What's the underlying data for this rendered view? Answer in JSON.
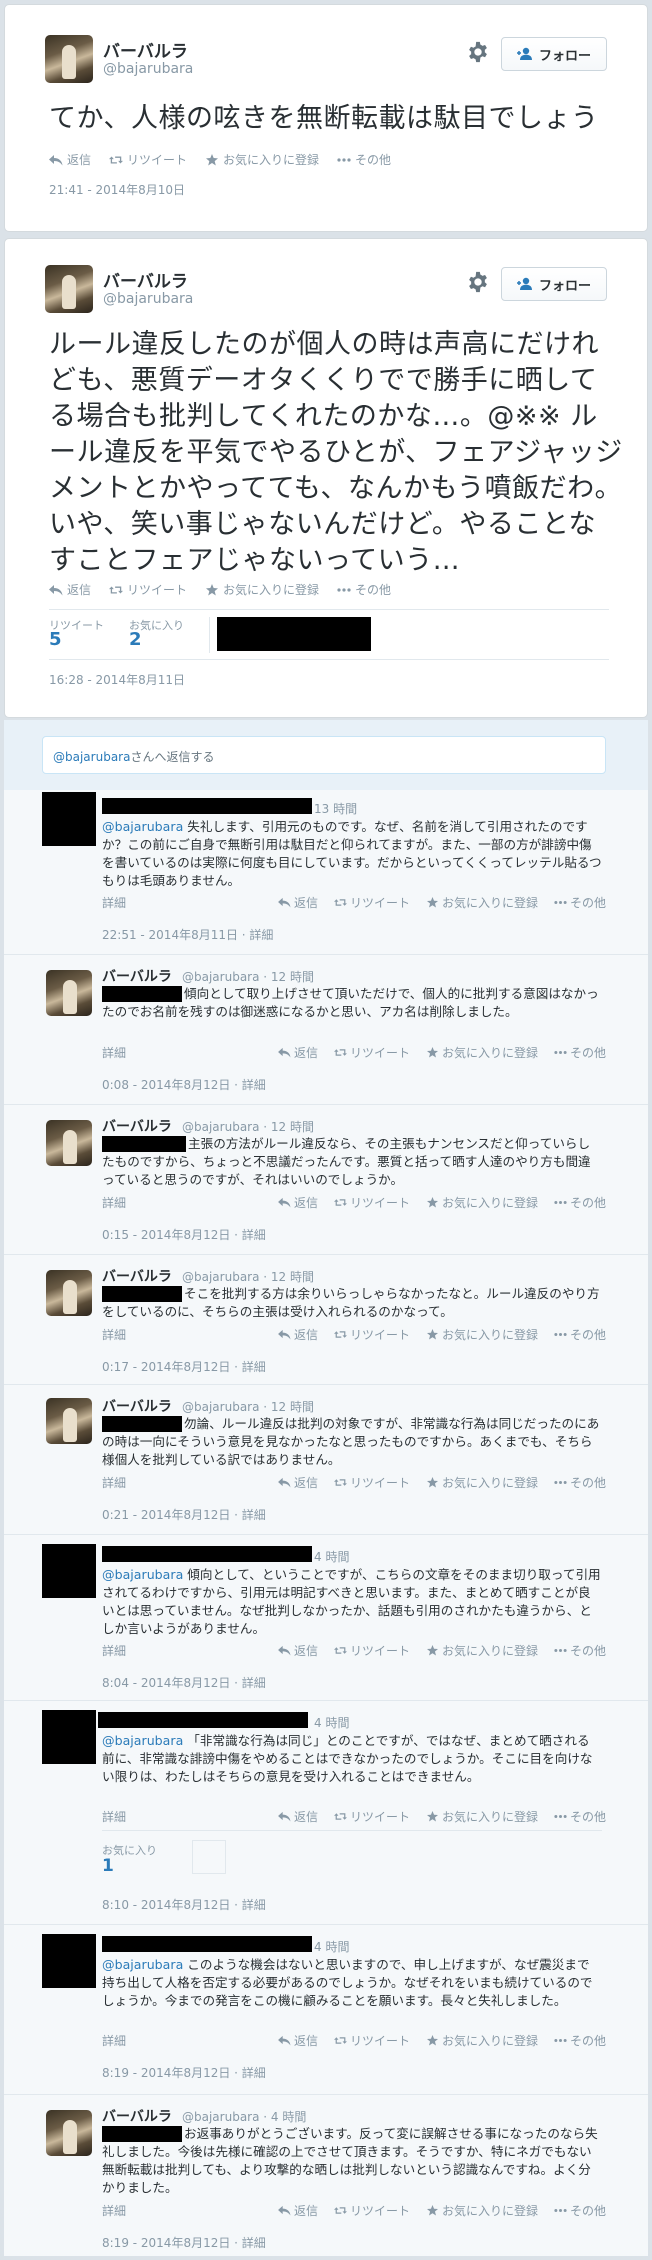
{
  "actions": {
    "reply": "返信",
    "retweet": "リツイート",
    "favorite": "お気に入りに登録",
    "more": "その他",
    "detail": "詳細"
  },
  "follow_label": "フォロー",
  "tweet1": {
    "name": "バーバルラ",
    "handle": "@bajarubara",
    "text": "てか、人様の呟きを無断転載は駄目でしょう",
    "timestamp": "21:41 - 2014年8月10日"
  },
  "tweet2": {
    "name": "バーバルラ",
    "handle": "@bajarubara",
    "text": "ルール違反したのが個人の時は声高にだけれども、悪質デーオタくくりでで勝手に晒してる場合も批判してくれたのかな…。@※※ ルール違反を平気でやるひとが、フェアジャッジメントとかやってても、なんかもう噴飯だわ。いや、笑い事じゃないんだけど。やることなすことフェアじゃないっていう…",
    "retweets_label": "リツイート",
    "retweets": "5",
    "favorites_label": "お気に入り",
    "favorites": "2",
    "timestamp": "16:28 - 2014年8月11日"
  },
  "reply_box": {
    "mention": "@bajarubara",
    "suffix": "さんへ返信する"
  },
  "replies": [
    {
      "name": "",
      "handle": "",
      "age": "13 時間",
      "mention": "@bajarubara",
      "text": " 失礼します、引用元のものです。なぜ、名前を消して引用されたのですか？この前にご自身で無断引用は駄目だと仰られてますが。また、一部の方が誹謗中傷を書いているのは実際に何度も目にしています。だからといってくくってレッテル貼るつもりは毛頭ありません。",
      "timestamp": "22:51 - 2014年8月11日 · 詳細"
    },
    {
      "name": "バーバルラ",
      "handle": "@bajarubara · 12 時間",
      "text": "傾向として取り上げさせて頂いただけで、個人的に批判する意図はなかったのでお名前を残すのは御迷惑になるかと思い、アカ名は削除しました。",
      "timestamp": "0:08 - 2014年8月12日 · 詳細"
    },
    {
      "name": "バーバルラ",
      "handle": "@bajarubara · 12 時間",
      "text": "主張の方法がルール違反なら、その主張もナンセンスだと仰っていらしたものですから、ちょっと不思議だったんです。悪質と括って晒す人達のやり方も間違っていると思うのですが、それはいいのでしょうか。",
      "timestamp": "0:15 - 2014年8月12日 · 詳細"
    },
    {
      "name": "バーバルラ",
      "handle": "@bajarubara · 12 時間",
      "text": "そこを批判する方は余りいらっしゃらなかったなと。ルール違反のやり方をしているのに、そちらの主張は受け入れられるのかなって。",
      "timestamp": "0:17 - 2014年8月12日 · 詳細"
    },
    {
      "name": "バーバルラ",
      "handle": "@bajarubara · 12 時間",
      "text": "勿論、ルール違反は批判の対象ですが、非常識な行為は同じだったのにあの時は一向にそういう意見を見なかったなと思ったものですから。あくまでも、そちら様個人を批判している訳ではありません。",
      "timestamp": "0:21 - 2014年8月12日 · 詳細"
    },
    {
      "age": "4 時間",
      "mention": "@bajarubara",
      "text": " 傾向として、ということですが、こちらの文章をそのまま切り取って引用されてるわけですから、引用元は明記すべきと思います。また、まとめて晒すことが良いとは思っていません。なぜ批判しなかったか、話題も引用のされかたも違うから、としか言いようがありません。",
      "timestamp": "8:04 - 2014年8月12日 · 詳細"
    },
    {
      "age": "4 時間",
      "mention": "@bajarubara",
      "text": " 「非常識な行為は同じ」とのことですが、ではなぜ、まとめて晒される前に、非常識な誹謗中傷をやめることはできなかったのでしょうか。そこに目を向けない限りは、わたしはそちらの意見を受け入れることはできません。",
      "favorites_label": "お気に入り",
      "favorites": "1",
      "timestamp": "8:10 - 2014年8月12日 · 詳細"
    },
    {
      "age": "4 時間",
      "mention": "@bajarubara",
      "text": " このような機会はないと思いますので、申し上げますが、なぜ震災まで持ち出して人格を否定する必要があるのでしょうか。なぜそれをいまも続けているのでしょうか。今までの発言をこの機に顧みることを願います。長々と失礼しました。",
      "timestamp": "8:19 - 2014年8月12日 · 詳細"
    },
    {
      "name": "バーバルラ",
      "handle": "@bajarubara · 4 時間",
      "text": "お返事ありがとうございます。反って変に誤解させる事になったのなら失礼しました。今後は先様に確認の上でさせて頂きます。そうですか、特にネガでもない無断転載は批判しても、より攻撃的な晒しは批判しないという認識なんですね。よく分かりました。",
      "timestamp": "8:19 - 2014年8月12日 · 詳細"
    }
  ],
  "colors": {
    "link": "#2b7bb9",
    "muted": "#8899a6",
    "background": "#dbe2e8"
  }
}
